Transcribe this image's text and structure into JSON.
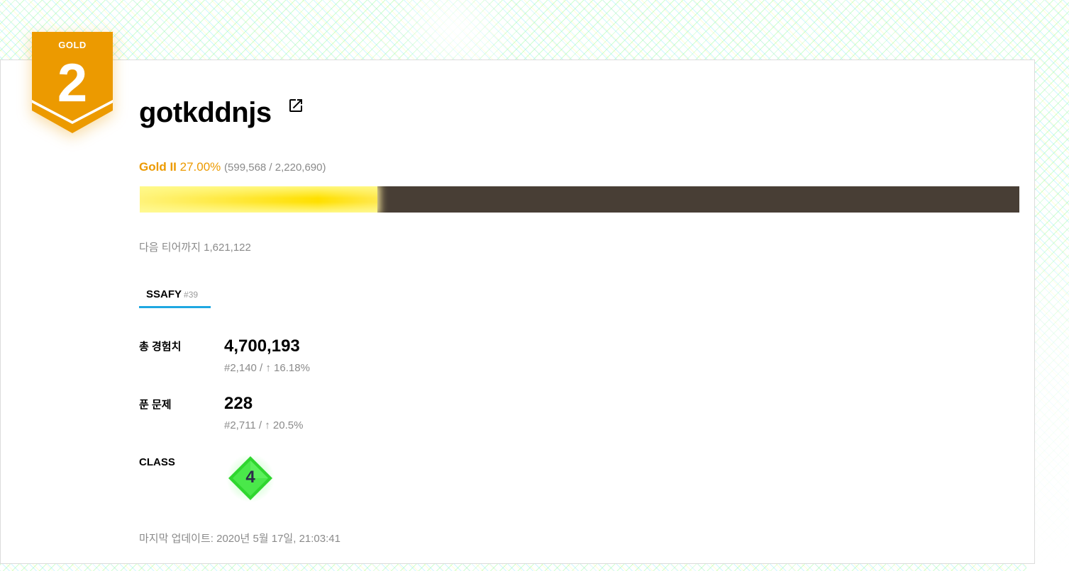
{
  "tier": {
    "badge_label": "GOLD",
    "badge_number": "2",
    "name": "Gold II",
    "percent_text": "27.00%",
    "exp_range_text": "(599,568 / 2,220,690)",
    "progress_fraction": 0.27,
    "color": "#ec9a00"
  },
  "user": {
    "handle": "gotkddnjs",
    "link_icon": "external-link-icon"
  },
  "next_tier_text": "다음 티어까지 1,621,122",
  "organization": {
    "name": "SSAFY",
    "rank": "#39",
    "underline_color": "#1ea7e1"
  },
  "stats": {
    "total_exp": {
      "label": "총 경험치",
      "value": "4,700,193",
      "rank_text": "#2,140 / ↑ 16.18%"
    },
    "solved": {
      "label": "푼 문제",
      "value": "228",
      "rank_text": "#2,711 / ↑ 20.5%"
    },
    "class": {
      "label": "CLASS",
      "value": "4",
      "badge_color": "#2fd62f"
    }
  },
  "last_updated_text": "마지막 업데이트: 2020년 5월 17일, 21:03:41"
}
